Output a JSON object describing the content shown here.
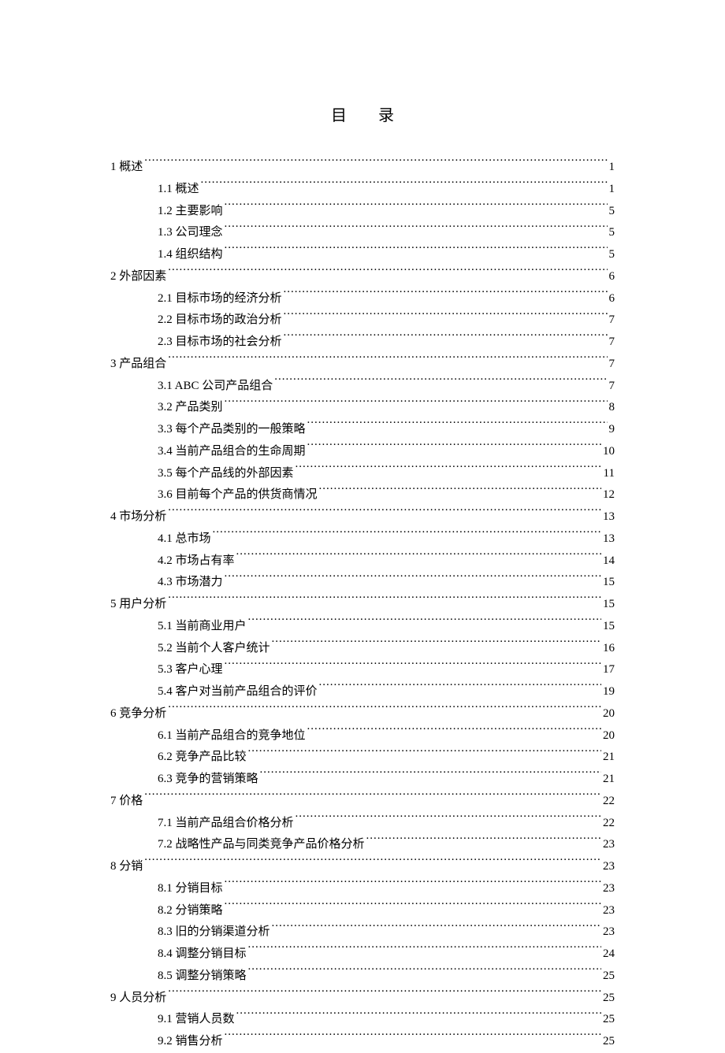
{
  "title": "目录",
  "toc": [
    {
      "level": 1,
      "num": "1",
      "label": "概述",
      "page": "1"
    },
    {
      "level": 2,
      "num": "1.1",
      "label": "概述",
      "page": "1"
    },
    {
      "level": 2,
      "num": "1.2",
      "label": "主要影响",
      "page": "5"
    },
    {
      "level": 2,
      "num": "1.3",
      "label": "公司理念",
      "page": "5"
    },
    {
      "level": 2,
      "num": "1.4",
      "label": "组织结构",
      "page": "5"
    },
    {
      "level": 1,
      "num": "2",
      "label": "外部因素",
      "page": "6"
    },
    {
      "level": 2,
      "num": "2.1",
      "label": "目标市场的经济分析",
      "page": "6"
    },
    {
      "level": 2,
      "num": "2.2",
      "label": "目标市场的政治分析",
      "page": "7"
    },
    {
      "level": 2,
      "num": "2.3",
      "label": "目标市场的社会分析",
      "page": "7"
    },
    {
      "level": 1,
      "num": "3",
      "label": "产品组合",
      "page": "7"
    },
    {
      "level": 2,
      "num": "3.1",
      "label": "ABC 公司产品组合 ",
      "page": "7"
    },
    {
      "level": 2,
      "num": "3.2",
      "label": "产品类别",
      "page": "8"
    },
    {
      "level": 2,
      "num": "3.3",
      "label": "每个产品类别的一般策略",
      "page": "9"
    },
    {
      "level": 2,
      "num": "3.4",
      "label": "当前产品组合的生命周期",
      "page": "10"
    },
    {
      "level": 2,
      "num": "3.5",
      "label": "每个产品线的外部因素",
      "page": "11"
    },
    {
      "level": 2,
      "num": "3.6",
      "label": "目前每个产品的供货商情况",
      "page": "12"
    },
    {
      "level": 1,
      "num": "4",
      "label": "市场分析",
      "page": "13"
    },
    {
      "level": 2,
      "num": "4.1",
      "label": "总市场",
      "page": "13"
    },
    {
      "level": 2,
      "num": "4.2",
      "label": "市场占有率",
      "page": "14"
    },
    {
      "level": 2,
      "num": "4.3",
      "label": "市场潜力",
      "page": "15"
    },
    {
      "level": 1,
      "num": "5",
      "label": "用户分析",
      "page": "15"
    },
    {
      "level": 2,
      "num": "5.1",
      "label": "当前商业用户",
      "page": "15"
    },
    {
      "level": 2,
      "num": "5.2",
      "label": "当前个人客户统计",
      "page": "16"
    },
    {
      "level": 2,
      "num": "5.3",
      "label": "客户心理",
      "page": "17"
    },
    {
      "level": 2,
      "num": "5.4",
      "label": "客户对当前产品组合的评价",
      "page": "19"
    },
    {
      "level": 1,
      "num": "6",
      "label": "竞争分析",
      "page": "20"
    },
    {
      "level": 2,
      "num": "6.1",
      "label": "当前产品组合的竞争地位",
      "page": "20"
    },
    {
      "level": 2,
      "num": "6.2",
      "label": "竞争产品比较",
      "page": "21"
    },
    {
      "level": 2,
      "num": "6.3",
      "label": "竞争的营销策略",
      "page": "21"
    },
    {
      "level": 1,
      "num": "7",
      "label": "价格",
      "page": "22"
    },
    {
      "level": 2,
      "num": "7.1",
      "label": "当前产品组合价格分析",
      "page": "22"
    },
    {
      "level": 2,
      "num": "7.2",
      "label": "战略性产品与同类竞争产品价格分析",
      "page": "23"
    },
    {
      "level": 1,
      "num": "8",
      "label": "分销",
      "page": "23"
    },
    {
      "level": 2,
      "num": "8.1",
      "label": "分销目标",
      "page": "23"
    },
    {
      "level": 2,
      "num": "8.2",
      "label": "分销策略",
      "page": "23"
    },
    {
      "level": 2,
      "num": "8.3",
      "label": "旧的分销渠道分析",
      "page": "23"
    },
    {
      "level": 2,
      "num": "8.4",
      "label": "调整分销目标",
      "page": "24"
    },
    {
      "level": 2,
      "num": "8.5",
      "label": "调整分销策略",
      "page": "25"
    },
    {
      "level": 1,
      "num": "9",
      "label": "人员分析",
      "page": "25"
    },
    {
      "level": 2,
      "num": "9.1",
      "label": "营销人员数",
      "page": "25"
    },
    {
      "level": 2,
      "num": "9.2",
      "label": "销售分析",
      "page": "25"
    }
  ]
}
